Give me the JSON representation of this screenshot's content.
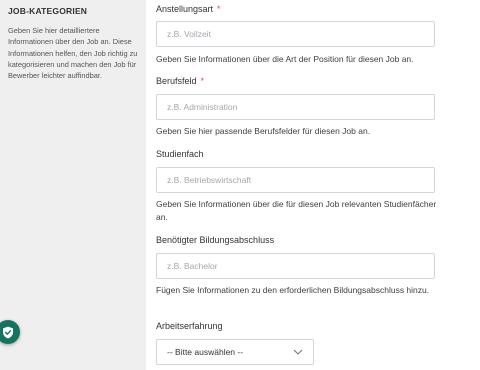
{
  "sidebar": {
    "title": "JOB-KATEGORIEN",
    "description": "Geben Sie hier detailliertere Informationen über den Job an. Diese Informationen helfen, den Job richtig zu kategorisieren und machen den Job für Bewerber leichter auffindbar."
  },
  "required_marker": "*",
  "form": {
    "employment_type": {
      "label": "Anstellungsart",
      "placeholder": "z.B. Vollzeit",
      "help": "Geben Sie Informationen über die Art der Position für diesen Job an."
    },
    "occupational_field": {
      "label": "Berufsfeld",
      "placeholder": "z.B. Administration",
      "help": "Geben Sie hier passende Berufsfelder für diesen Job an."
    },
    "field_of_study": {
      "label": "Studienfach",
      "placeholder": "z.B. Betriebswirtschaft",
      "help": "Geben Sie Informationen über die für diesen Job relevanten Studienfächer an."
    },
    "education": {
      "label": "Benötigter Bildungsabschluss",
      "placeholder": "z.B. Bachelor",
      "help": "Fügen Sie Informationen zu den erforderlichen Bildungsabschluss hinzu."
    },
    "experience": {
      "label": "Arbeitserfahrung",
      "selected": "-- Bitte auswählen --"
    }
  },
  "icons": {
    "privacy": "shield-check-icon",
    "dropdown": "chevron-down-icon"
  },
  "colors": {
    "sidebar_bg": "#efefef",
    "required": "#d9534f",
    "privacy_button": "#16735f",
    "input_border": "#cfd7dc"
  }
}
